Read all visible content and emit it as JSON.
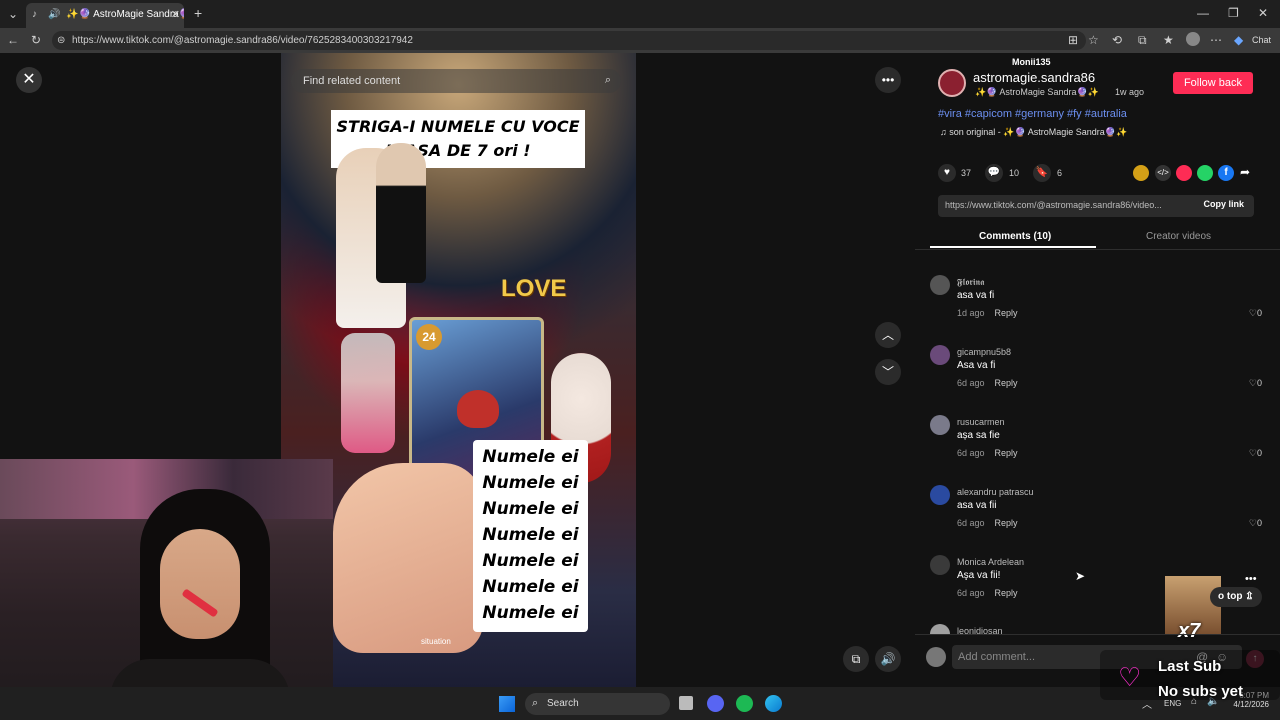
{
  "browser": {
    "tab_title": "✨🔮 AstroMagie Sandra🔮✨",
    "url": "https://www.tiktok.com/@astromagie.sandra86/video/7625283400303217942",
    "chat_label": "Chat"
  },
  "video": {
    "search_placeholder": "Find related content",
    "overlay_title": "STRIGA-I NUMELE CU VOCE JOASA DE 7 ori !",
    "love_text": "LOVE",
    "name_lines": [
      "Numele ei",
      "Numele ei",
      "Numele ei",
      "Numele ei",
      "Numele ei",
      "Numele ei",
      "Numele ei"
    ],
    "card_number": "24",
    "situation_text": "situation"
  },
  "post": {
    "username": "astromagie.sandra86",
    "display_name": "✨🔮 AstroMagie Sandra🔮✨",
    "age": "1w ago",
    "follow_label": "Follow back",
    "hashtags": "#vira #capicom #germany #fy #autralia",
    "sound": "son original - ✨🔮 AstroMagie Sandra🔮✨",
    "likes": "37",
    "comments_count": "10",
    "saves": "6",
    "link_preview": "https://www.tiktok.com/@astromagie.sandra86/video...",
    "copy_link_label": "Copy link",
    "overlay_user": "Monii135"
  },
  "tabs": {
    "comments": "Comments (10)",
    "creator_videos": "Creator videos"
  },
  "comments": [
    {
      "user": "𝕱𝖑𝖔𝖗𝖎𝖓𝖆",
      "text": "asa va fi",
      "age": "1d ago",
      "reply": "Reply",
      "likes": "0"
    },
    {
      "user": "gicampnu5b8",
      "text": "Asa va fi",
      "age": "6d ago",
      "reply": "Reply",
      "likes": "0"
    },
    {
      "user": "rusucarmen",
      "text": "așa sa fie",
      "age": "6d ago",
      "reply": "Reply",
      "likes": "0"
    },
    {
      "user": "alexandru patrascu",
      "text": "asa va fii",
      "age": "6d ago",
      "reply": "Reply",
      "likes": "0"
    },
    {
      "user": "Monica Ardelean",
      "text": "Aşa va fii!",
      "age": "6d ago",
      "reply": "Reply",
      "likes": "0"
    },
    {
      "user": "leonidiosan",
      "text": "",
      "age": "",
      "reply": "",
      "likes": ""
    }
  ],
  "comment_input_placeholder": "Add comment...",
  "back_to_top_label": "o top ⇫",
  "stream_overlay": {
    "multiplier": "x7",
    "last_sub_label": "Last Sub",
    "no_subs_label": "No subs yet"
  },
  "taskbar": {
    "search_label": "Search",
    "lang": "ENG",
    "time": "6:07 PM",
    "date": "4/12/2026"
  },
  "colors": {
    "accent": "#fe2c55",
    "hashtag": "#6c8ff0"
  }
}
